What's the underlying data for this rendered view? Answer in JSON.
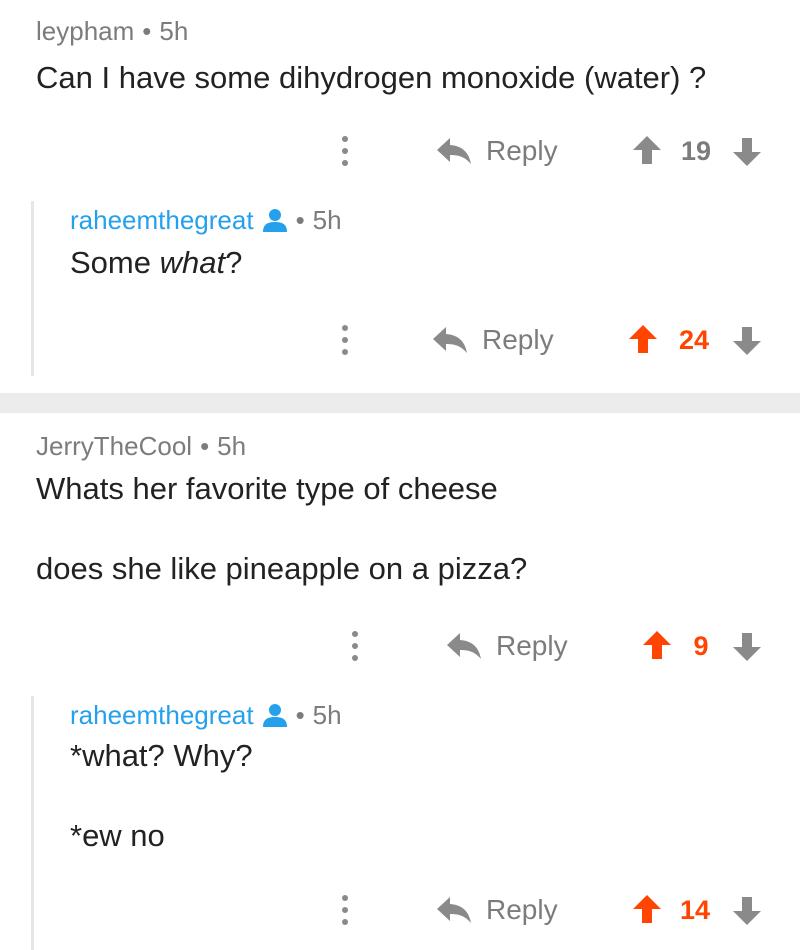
{
  "colors": {
    "upvoted": "#ff4500",
    "neutral": "#7c7c7c",
    "op_author": "#24a0ed",
    "separator": "#ececec"
  },
  "threads": [
    {
      "comment": {
        "author": "leypham",
        "time": "5h",
        "body": [
          "Can I have some dihydrogen monoxide (water) ?"
        ],
        "reply_label": "Reply",
        "score": "19",
        "vote_state": "none"
      },
      "reply": {
        "author": "raheemthegreat",
        "author_icon": "user-icon",
        "time": "5h",
        "body_prefix": "Some ",
        "body_italic": "what",
        "body_suffix": "?",
        "reply_label": "Reply",
        "score": "24",
        "vote_state": "upvoted"
      }
    },
    {
      "comment": {
        "author": "JerryTheCool",
        "time": "5h",
        "body": [
          "Whats her favorite type of cheese",
          "does she like pineapple on a pizza?"
        ],
        "reply_label": "Reply",
        "score": "9",
        "vote_state": "upvoted"
      },
      "reply": {
        "author": "raheemthegreat",
        "author_icon": "user-icon",
        "time": "5h",
        "body": [
          "*what? Why?",
          "*ew no"
        ],
        "reply_label": "Reply",
        "score": "14",
        "vote_state": "upvoted"
      }
    }
  ]
}
